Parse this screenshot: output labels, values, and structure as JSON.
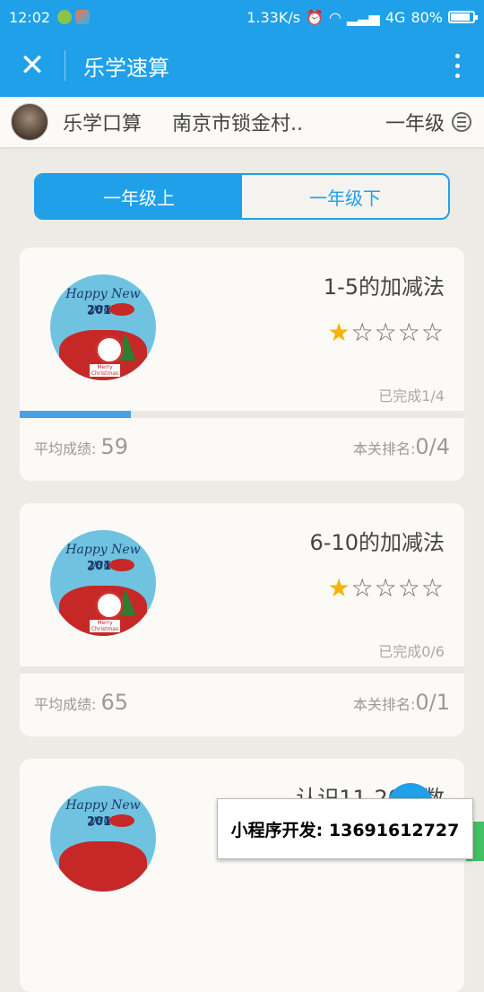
{
  "status": {
    "time": "12:02",
    "speed": "1.33K/s",
    "network": "4G",
    "battery": "80%"
  },
  "appbar": {
    "title": "乐学速算"
  },
  "school": {
    "app_name": "乐学口算",
    "school_name": "南京市锁金村..",
    "grade": "一年级"
  },
  "tabs": [
    {
      "label": "一年级上",
      "active": true
    },
    {
      "label": "一年级下",
      "active": false
    }
  ],
  "badge": {
    "greeting": "Happy New year",
    "year": "2017",
    "note": "Merry Christmas"
  },
  "cards": [
    {
      "title": "1-5的加减法",
      "stars_filled": 1,
      "stars_total": 5,
      "completed": "已完成1/4",
      "progress": 0.25,
      "avg_label": "平均成绩:",
      "avg_value": "59",
      "rank_label": "本关排名:",
      "rank_value": "0/4"
    },
    {
      "title": "6-10的加减法",
      "stars_filled": 1,
      "stars_total": 5,
      "completed": "已完成0/6",
      "progress": 0,
      "avg_label": "平均成绩:",
      "avg_value": "65",
      "rank_label": "本关排名:",
      "rank_value": "0/1"
    },
    {
      "title": "认识11-20各数"
    }
  ],
  "promo": {
    "text": "小程序开发: 13691612727"
  },
  "colors": {
    "primary": "#1fa0e8",
    "star": "#f5b400",
    "progress": "#4aa0e0",
    "background": "#ecebe6"
  }
}
